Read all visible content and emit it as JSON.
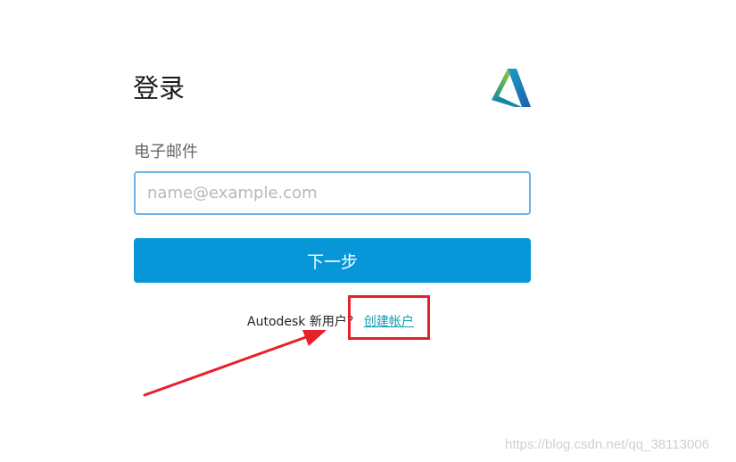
{
  "login": {
    "title": "登录",
    "email_label": "电子邮件",
    "email_placeholder": "name@example.com",
    "email_value": "",
    "next_button": "下一步",
    "new_user_text": "Autodesk 新用户？",
    "create_account_link": "创建帐户"
  },
  "brand": {
    "logo_icon": "autodesk-logo-icon",
    "accent_color": "#0796d8"
  },
  "annotation": {
    "highlight_color": "#e8202a"
  },
  "watermark": "https://blog.csdn.net/qq_38113006"
}
